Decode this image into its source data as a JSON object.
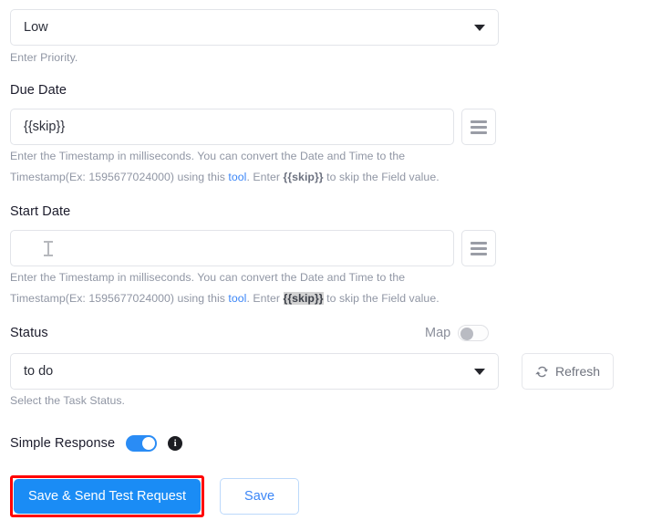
{
  "priority": {
    "name": "Priority",
    "value": "Low",
    "help": "Enter Priority.",
    "icon": "chevron-down-icon"
  },
  "due_date": {
    "label": "Due Date",
    "value": "{{skip}}",
    "menu_icon": "hamburger-icon",
    "help": {
      "line1": "Enter the Timestamp in milliseconds. You can convert the Date and Time to the",
      "prefix2": "Timestamp(Ex: 1595677024000) using this ",
      "link": "tool",
      "mid2": ". Enter ",
      "skip_token": "{{skip}}",
      "suffix2": " to skip the Field value."
    }
  },
  "start_date": {
    "label": "Start Date",
    "value": "",
    "placeholder": "",
    "menu_icon": "hamburger-icon",
    "cursor": "text-ibeam-cursor",
    "help": {
      "line1": "Enter the Timestamp in milliseconds. You can convert the Date and Time to the",
      "prefix2": "Timestamp(Ex: 1595677024000) using this ",
      "link": "tool",
      "mid2": ". Enter ",
      "skip_token": "{{skip}}",
      "suffix2": " to skip the Field value."
    }
  },
  "status": {
    "label": "Status",
    "value": "to do",
    "help": "Select the Task Status.",
    "map": {
      "label": "Map",
      "state": "off"
    },
    "refresh": {
      "label": "Refresh",
      "icon": "refresh-icon"
    },
    "icon": "chevron-down-icon"
  },
  "simple_response": {
    "label": "Simple Response",
    "state": "on",
    "info_icon": "info-icon",
    "info_glyph": "i"
  },
  "actions": {
    "primary_label": "Save & Send Test Request",
    "secondary_label": "Save",
    "highlight_color": "#ff0000"
  },
  "colors": {
    "accent_blue": "#1a8cf5",
    "link_blue": "#3b86f7",
    "label_text": "#1b1b2b",
    "help_text": "#9096a4",
    "border": "#e2e4e9",
    "highlight_red": "#ff0000",
    "toggle_on": "#2a8cf5",
    "skip_selection_bg": "#d2d2d2"
  }
}
